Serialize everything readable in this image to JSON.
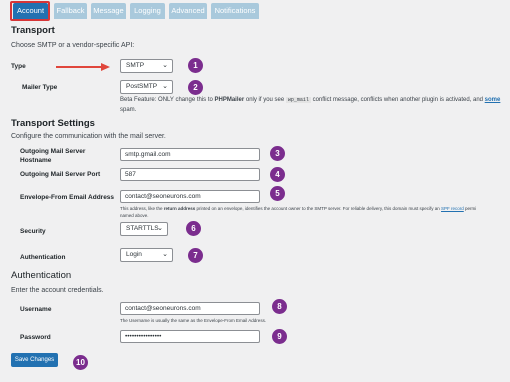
{
  "tabs": [
    "Account",
    "Fallback",
    "Message",
    "Logging",
    "Advanced",
    "Notifications"
  ],
  "transport": {
    "heading": "Transport",
    "description": "Choose SMTP or a vendor-specific API:",
    "type_label": "Type",
    "type_value": "SMTP",
    "mailer_label": "Mailer Type",
    "mailer_value": "PostSMTP",
    "mailer_note_1": "Beta Feature: ONLY change this to ",
    "mailer_note_bold": "PHPMailer",
    "mailer_note_2": " only if you see ",
    "mailer_note_code": "wp_mail",
    "mailer_note_3": " conflict message, conflicts when another plugin is activated, and ",
    "mailer_note_link": "some",
    "mailer_note_4": "spam."
  },
  "transport_settings": {
    "heading": "Transport Settings",
    "description": "Configure the communication with the mail server.",
    "server_label_1": "Outgoing Mail Server",
    "server_label_2": "Hostname",
    "server_value": "smtp.gmail.com",
    "port_label": "Outgoing Mail Server Port",
    "port_value": "587",
    "envelope_label": "Envelope-From Email Address",
    "envelope_value": "contact@seoneurons.com",
    "envelope_note_1": "This address, like the ",
    "envelope_note_bold": "return address",
    "envelope_note_2": " printed on an envelope, identifies the account owner to the SMTP server. For reliable delivery, this domain must specify an ",
    "envelope_note_link": "SPF record",
    "envelope_note_3": " permi",
    "envelope_note_4": "named above.",
    "security_label": "Security",
    "security_value": "STARTTLS",
    "auth_label": "Authentication",
    "auth_value": "Login"
  },
  "authentication": {
    "heading": "Authentication",
    "description": "Enter the account credentials.",
    "username_label": "Username",
    "username_value": "contact@seoneurons.com",
    "username_note": "The Username is usually the same as the Envelope-From Email Address.",
    "password_label": "Password",
    "password_value": "••••••••••••••••"
  },
  "save_button": "Save Changes",
  "badges": [
    "1",
    "2",
    "3",
    "4",
    "5",
    "6",
    "7",
    "8",
    "9",
    "10"
  ],
  "colors": {
    "accent": "#2271b1",
    "badge": "#7b2d8e",
    "arrow": "#e0463c",
    "highlight": "#d63638"
  },
  "icons": {
    "caret": "chevron-down-icon",
    "arrow": "red-arrow-icon"
  }
}
